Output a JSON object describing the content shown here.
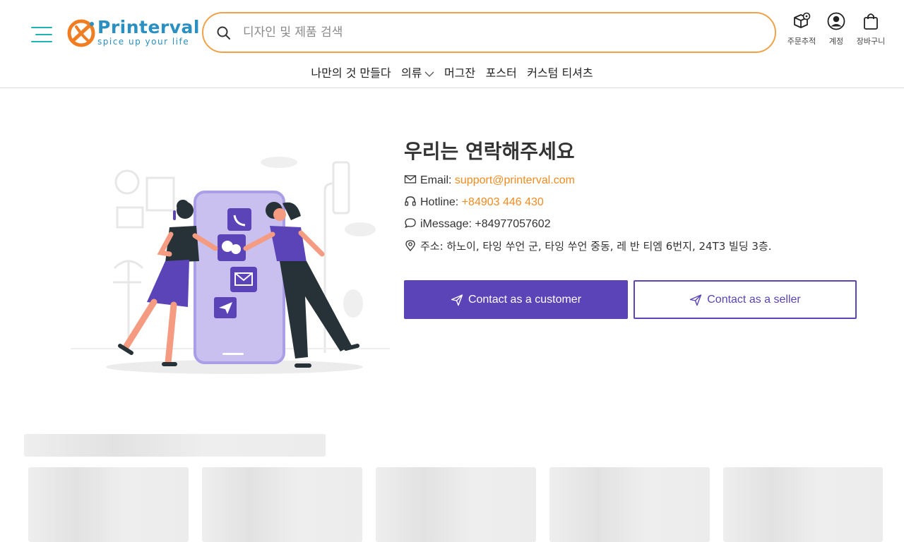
{
  "header": {
    "logo": {
      "name": "Printerval",
      "tagline": "spice up your life"
    },
    "search": {
      "placeholder": "디자인 및 제품 검색"
    },
    "actions": [
      {
        "label": "주문추적",
        "icon": "order-tracking-icon"
      },
      {
        "label": "계정",
        "icon": "account-icon"
      },
      {
        "label": "장바구니",
        "icon": "cart-icon"
      }
    ]
  },
  "nav": {
    "items": [
      "나만의 것 만들다",
      "의류",
      "머그잔",
      "포스터",
      "커스텀 티셔츠"
    ]
  },
  "contact": {
    "title": "우리는 연락해주세요",
    "email_label": "Email:",
    "email": "support@printerval.com",
    "hotline_label": "Hotline:",
    "hotline": "+84903 446 430",
    "imessage": "iMessage: +84977057602",
    "address": "주소: 하노이, 타잉 쑤언 군, 타잉 쑤언 중동, 레 반 티엠 6번지, 24T3 빌딩 3층.",
    "buttons": {
      "customer": "Contact as a customer",
      "seller": "Contact as a seller"
    }
  },
  "colors": {
    "accent_orange": "#f28b21",
    "brand_purple": "#5b43b8",
    "logo_blue": "#2a8fc1",
    "menu_teal": "#1fb4b4"
  }
}
